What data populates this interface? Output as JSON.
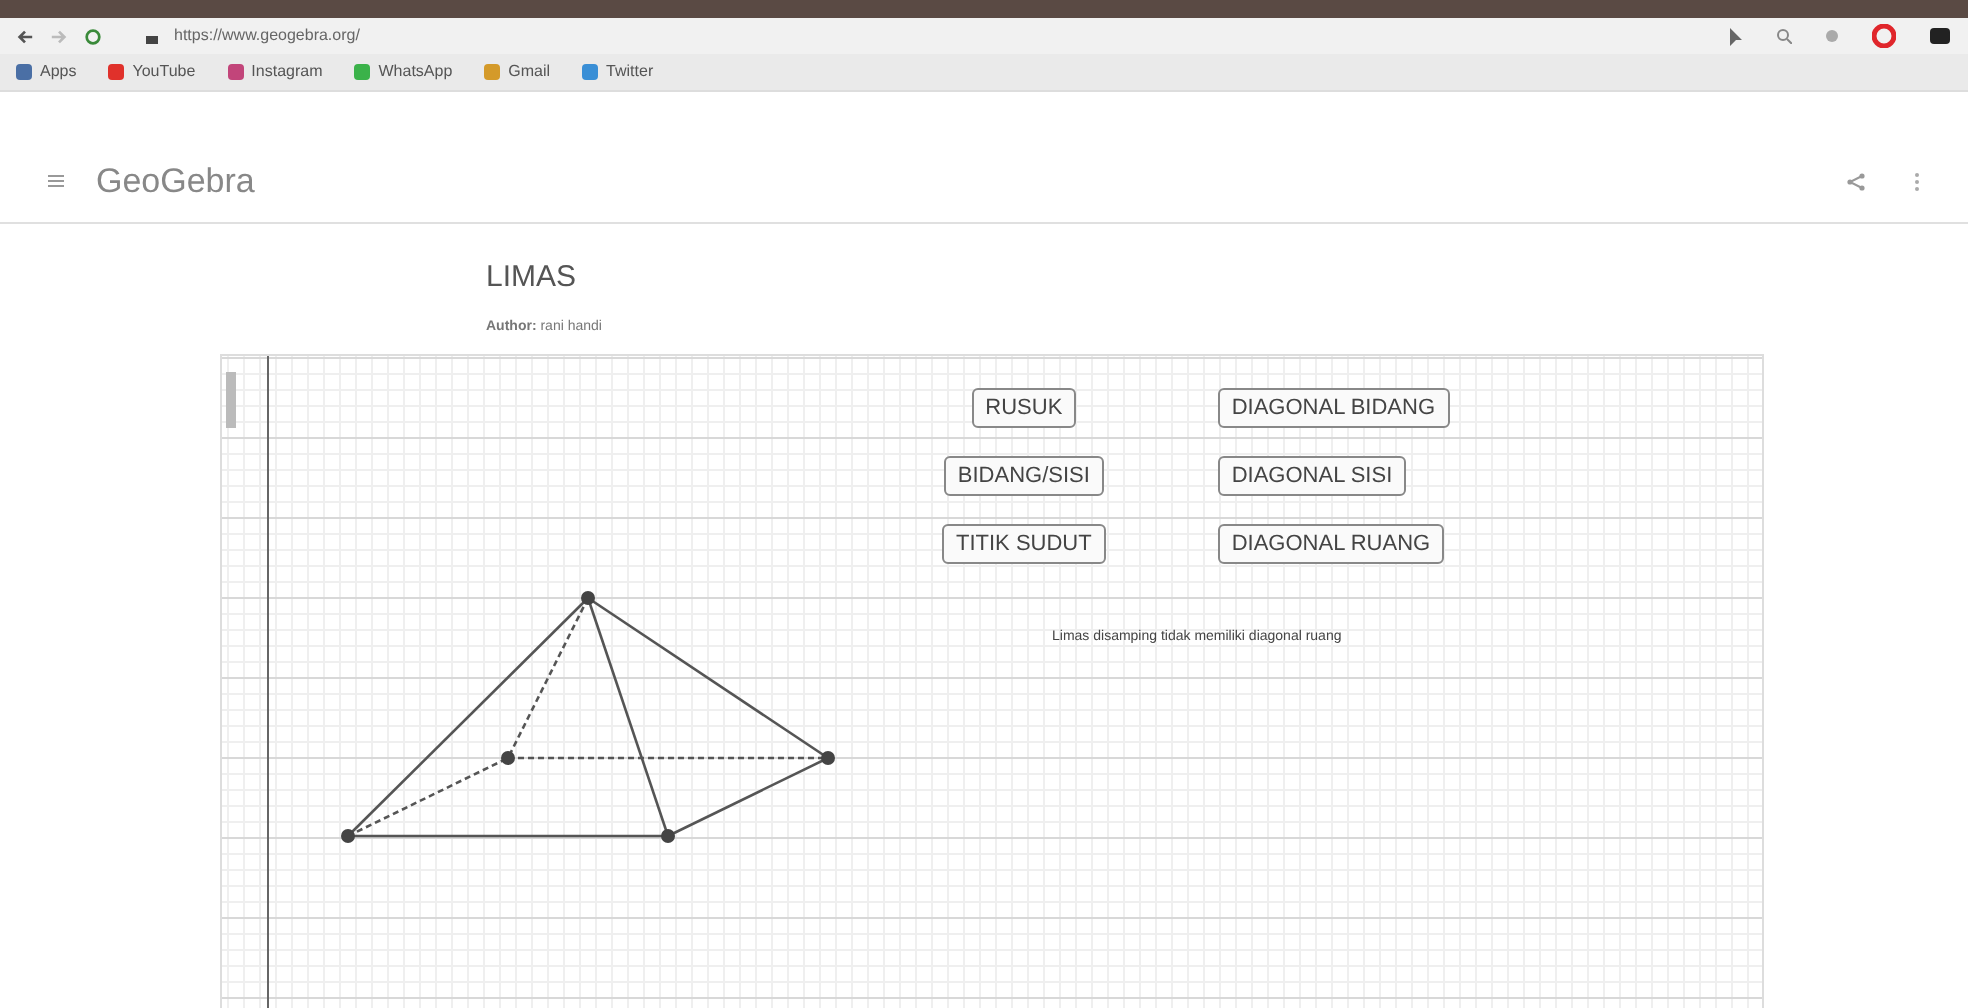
{
  "browser": {
    "url": "https://www.geogebra.org/",
    "bookmarks": [
      {
        "label": "Apps",
        "color": "#4a6fa5"
      },
      {
        "label": "YouTube",
        "color": "#e0312b"
      },
      {
        "label": "Instagram",
        "color": "#c2457a"
      },
      {
        "label": "WhatsApp",
        "color": "#3bb24a"
      },
      {
        "label": "Gmail",
        "color": "#d49a2a"
      },
      {
        "label": "Twitter",
        "color": "#3a8fd6"
      }
    ]
  },
  "header": {
    "title": "GeoGebra"
  },
  "applet": {
    "title": "LIMAS",
    "author_label": "Author:",
    "author": "rani handi",
    "buttons": [
      {
        "label": "RUSUK"
      },
      {
        "label": "DIAGONAL BIDANG"
      },
      {
        "label": "BIDANG/SISI"
      },
      {
        "label": "DIAGONAL SISI"
      },
      {
        "label": "TITIK SUDUT"
      },
      {
        "label": "DIAGONAL RUANG"
      }
    ],
    "note": "Limas disamping tidak memiliki diagonal ruang"
  }
}
